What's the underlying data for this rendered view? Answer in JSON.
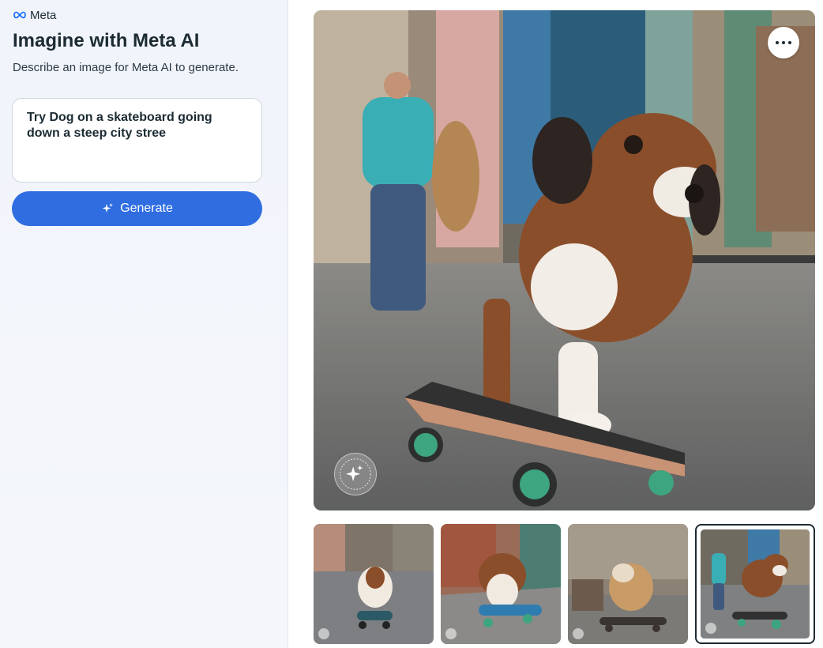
{
  "brand": {
    "name": "Meta",
    "logo_icon": "meta-infinity-icon",
    "logo_color": "#0866ff"
  },
  "header": {
    "title": "Imagine with Meta AI",
    "subtitle": "Describe an image for Meta AI to generate."
  },
  "prompt": {
    "value": "Try Dog on a skateboard going\ndown a steep city stree"
  },
  "generate": {
    "label": "Generate",
    "icon": "sparkle-icon",
    "color": "#2f6de1"
  },
  "main_image": {
    "alt": "Dog on a skateboard going down a city street",
    "more_icon": "more-horizontal-icon",
    "badge_icon": "imagined-with-ai-badge-icon"
  },
  "thumbnails": [
    {
      "alt": "Dog skating down steep street",
      "selected": false
    },
    {
      "alt": "Dog on blue skateboard on steps",
      "selected": false
    },
    {
      "alt": "Dog skateboarding in crowded street",
      "selected": false
    },
    {
      "alt": "Dog on skateboard with pedestrian",
      "selected": true
    }
  ]
}
